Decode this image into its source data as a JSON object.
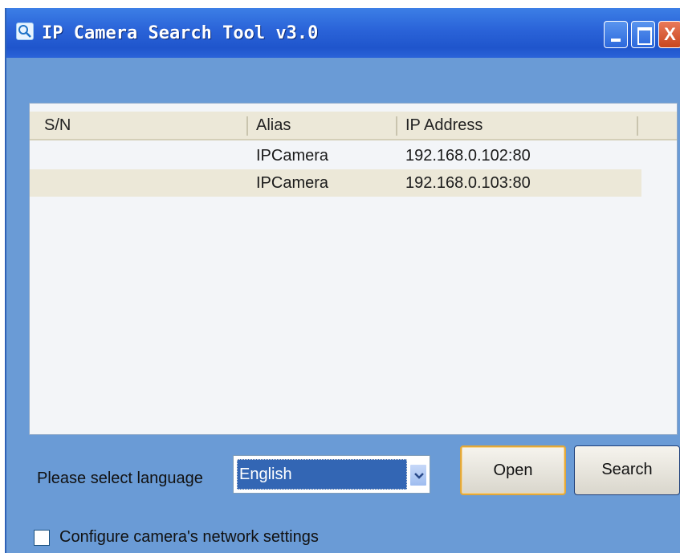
{
  "window": {
    "title": "IP Camera Search Tool  v3.0",
    "close_glyph": "X"
  },
  "device_list": {
    "columns": [
      "S/N",
      "Alias",
      "IP Address"
    ],
    "rows": [
      {
        "sn": "",
        "alias": "IPCamera",
        "ip": "192.168.0.102:80"
      },
      {
        "sn": "",
        "alias": "IPCamera",
        "ip": "192.168.0.103:80"
      }
    ]
  },
  "language": {
    "label": "Please select language",
    "selected": "English"
  },
  "buttons": {
    "open": "Open",
    "search": "Search"
  },
  "network_settings": {
    "label": "Configure camera's network settings",
    "checked": false
  },
  "colors": {
    "titlebar": "#2a63d8",
    "window_body": "#6a9bd6",
    "selection": "#3366b4",
    "alt_row": "#ece8d8"
  },
  "icons": {
    "app": "magnifier-icon",
    "minimize": "minimize-icon",
    "maximize": "maximize-icon",
    "close": "close-icon",
    "dropdown": "chevron-down-icon"
  }
}
